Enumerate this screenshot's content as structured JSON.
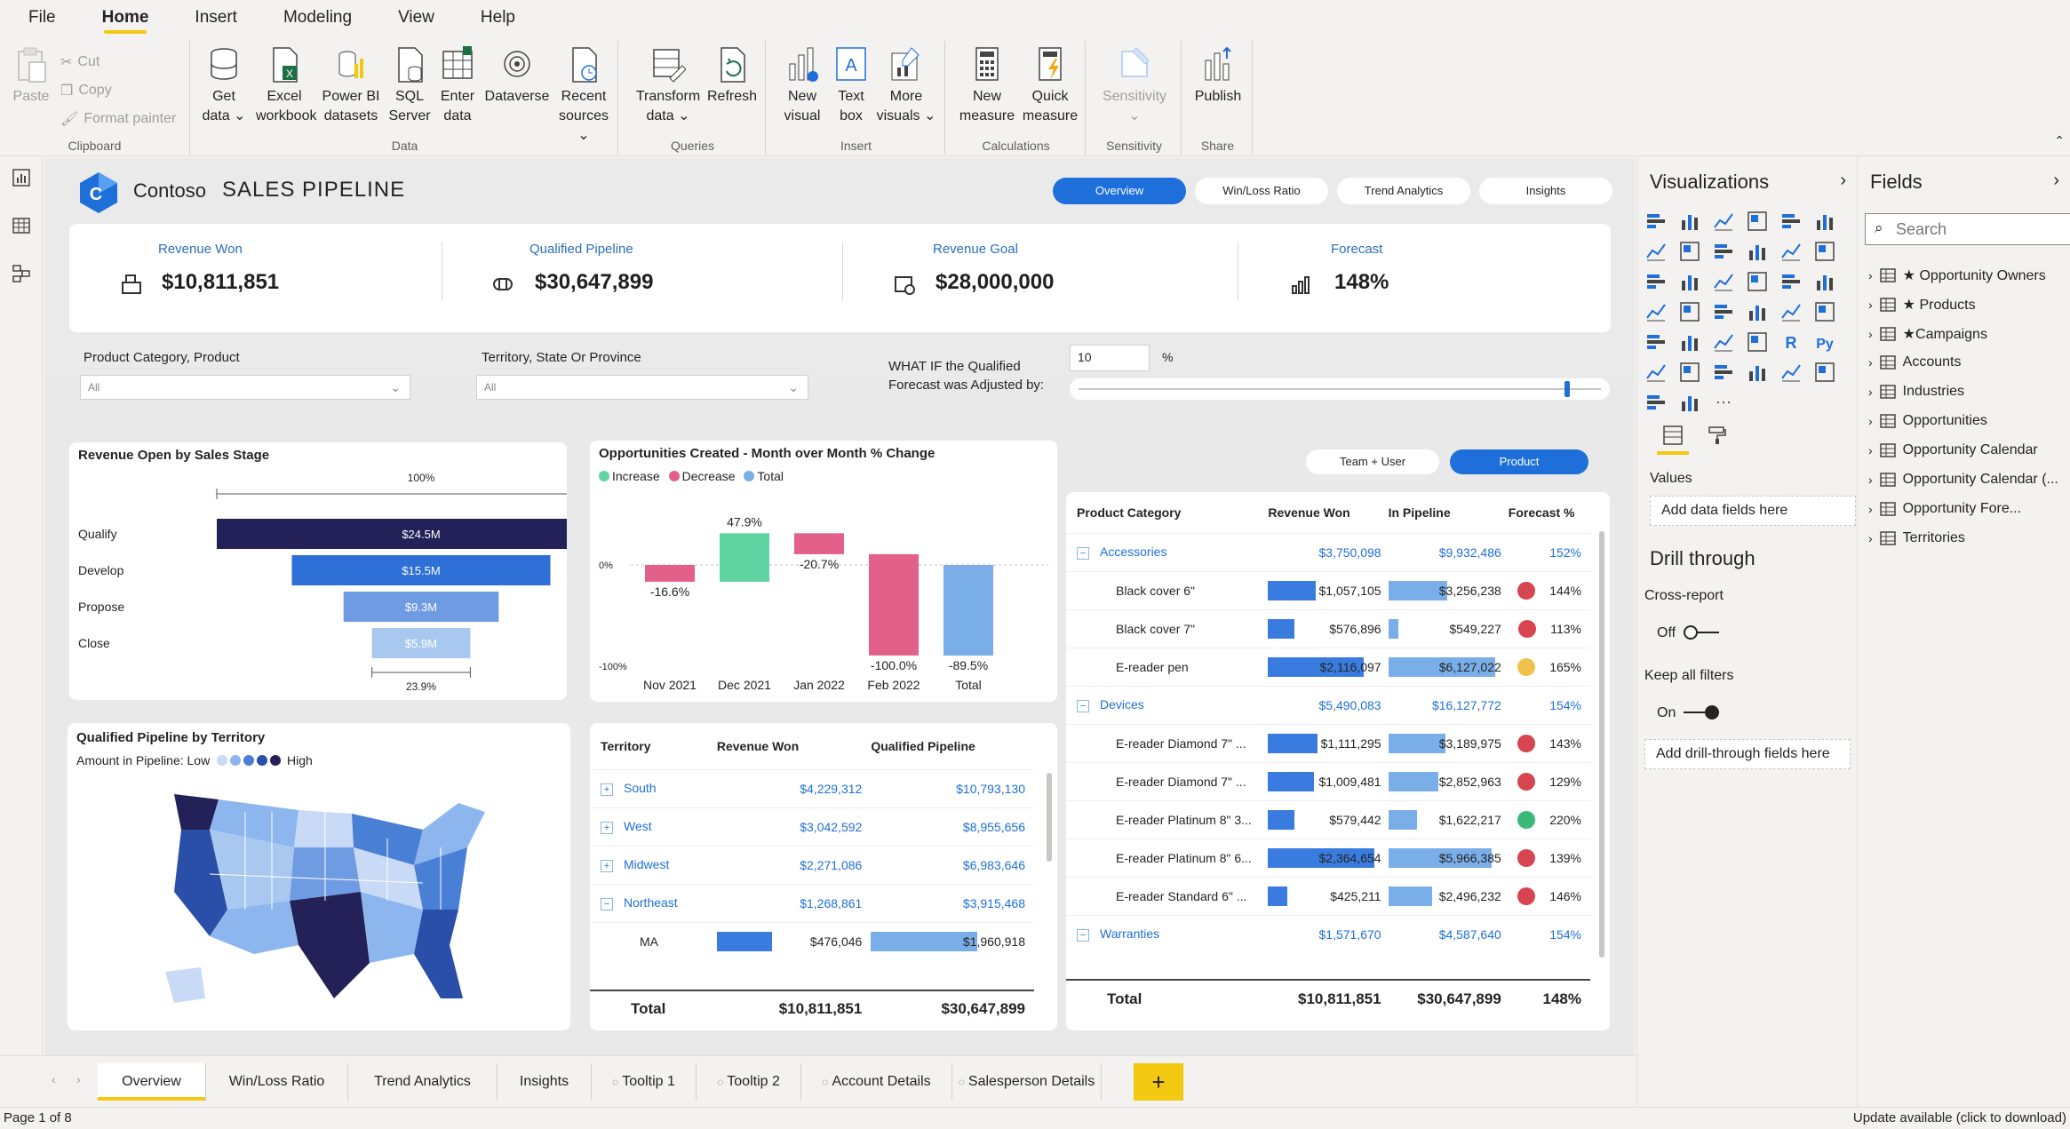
{
  "menu": [
    "File",
    "Home",
    "Insert",
    "Modeling",
    "View",
    "Help"
  ],
  "ribbon": {
    "clipboard": {
      "paste": "Paste",
      "cut": "Cut",
      "copy": "Copy",
      "format_painter": "Format painter",
      "label": "Clipboard"
    },
    "data": {
      "get_data_1": "Get",
      "get_data_2": "data",
      "excel_1": "Excel",
      "excel_2": "workbook",
      "pbi_1": "Power BI",
      "pbi_2": "datasets",
      "sql_1": "SQL",
      "sql_2": "Server",
      "enter_1": "Enter",
      "enter_2": "data",
      "dataverse": "Dataverse",
      "recent_1": "Recent",
      "recent_2": "sources",
      "label": "Data"
    },
    "queries": {
      "transform_1": "Transform",
      "transform_2": "data",
      "refresh": "Refresh",
      "label": "Queries"
    },
    "insert": {
      "new_visual_1": "New",
      "new_visual_2": "visual",
      "textbox_1": "Text",
      "textbox_2": "box",
      "more_1": "More",
      "more_2": "visuals",
      "label": "Insert"
    },
    "calculations": {
      "new_measure_1": "New",
      "new_measure_2": "measure",
      "quick_1": "Quick",
      "quick_2": "measure",
      "label": "Calculations"
    },
    "sensitivity": {
      "btn": "Sensitivity",
      "label": "Sensitivity"
    },
    "share": {
      "publish": "Publish",
      "label": "Share"
    }
  },
  "report": {
    "brand": "Contoso",
    "title": "SALES PIPELINE",
    "nav": [
      "Overview",
      "Win/Loss Ratio",
      "Trend Analytics",
      "Insights"
    ],
    "kpis": [
      {
        "label": "Revenue Won",
        "value": "$10,811,851"
      },
      {
        "label": "Qualified Pipeline",
        "value": "$30,647,899"
      },
      {
        "label": "Revenue Goal",
        "value": "$28,000,000"
      },
      {
        "label": "Forecast",
        "value": "148%"
      }
    ],
    "slicers": {
      "product_label": "Product Category, Product",
      "product_value": "All",
      "territory_label": "Territory, State Or Province",
      "territory_value": "All",
      "whatif_label_1": "WHAT IF the Qualified",
      "whatif_label_2": "Forecast was Adjusted by:",
      "whatif_value": "10",
      "whatif_unit": "%",
      "whatif_level": 0.93
    }
  },
  "chart_data": [
    {
      "type": "bar",
      "title": "Revenue Open by Sales Stage",
      "categories": [
        "Qualify",
        "Develop",
        "Propose",
        "Close"
      ],
      "values": [
        24.5,
        15.5,
        9.3,
        5.9
      ],
      "labels": [
        "$24.5M",
        "$15.5M",
        "$9.3M",
        "$5.9M"
      ],
      "top_label": "100%",
      "bottom_label": "23.9%"
    },
    {
      "type": "bar",
      "title": "Opportunities Created - Month over Month % Change",
      "legend": [
        "Increase",
        "Decrease",
        "Total"
      ],
      "categories": [
        "Nov 2021",
        "Dec 2021",
        "Jan 2022",
        "Feb 2022",
        "Total"
      ],
      "values": [
        -16.6,
        47.9,
        -20.7,
        -100.0,
        -89.5
      ],
      "labels": [
        "-16.6%",
        "47.9%",
        "-20.7%",
        "-100.0%",
        "-89.5%"
      ],
      "yticks": [
        "0%",
        "-100%"
      ]
    }
  ],
  "map": {
    "title": "Qualified Pipeline by Territory",
    "legend_label": "Amount in Pipeline: Low",
    "legend_high": "High"
  },
  "territory_table": {
    "headers": [
      "Territory",
      "Revenue Won",
      "Qualified Pipeline"
    ],
    "rows": [
      {
        "name": "South",
        "won": "$4,229,312",
        "pipe": "$10,793,130"
      },
      {
        "name": "West",
        "won": "$3,042,592",
        "pipe": "$8,955,656"
      },
      {
        "name": "Midwest",
        "won": "$2,271,086",
        "pipe": "$6,983,646"
      },
      {
        "name": "Northeast",
        "won": "$1,268,861",
        "pipe": "$3,915,468"
      }
    ],
    "sub": {
      "name": "MA",
      "won": "$476,046",
      "pipe": "$1,960,918"
    },
    "total": {
      "label": "Total",
      "won": "$10,811,851",
      "pipe": "$30,647,899"
    }
  },
  "product_table": {
    "toggle": [
      "Team + User",
      "Product"
    ],
    "headers": [
      "Product Category",
      "Revenue Won",
      "In Pipeline",
      "Forecast %"
    ],
    "rows": [
      {
        "type": "cat",
        "name": "Accessories",
        "won": "$3,750,098",
        "pipe": "$9,932,486",
        "fc": "152%"
      },
      {
        "type": "item",
        "name": "Black cover 6\"",
        "won": "$1,057,105",
        "pipe": "$3,256,238",
        "fc": "144%",
        "dot": "#d64550",
        "wf": 0.45,
        "pf": 0.55
      },
      {
        "type": "item",
        "name": "Black cover 7\"",
        "won": "$576,896",
        "pipe": "$549,227",
        "fc": "113%",
        "dot": "#d64550",
        "wf": 0.25,
        "pf": 0.09
      },
      {
        "type": "item",
        "name": "E-reader pen",
        "won": "$2,116,097",
        "pipe": "$6,127,022",
        "fc": "165%",
        "dot": "#f0c24b",
        "wf": 0.9,
        "pf": 1.0
      },
      {
        "type": "cat",
        "name": "Devices",
        "won": "$5,490,083",
        "pipe": "$16,127,772",
        "fc": "154%"
      },
      {
        "type": "item",
        "name": "E-reader Diamond 7\" ...",
        "won": "$1,111,295",
        "pipe": "$3,189,975",
        "fc": "143%",
        "dot": "#d64550",
        "wf": 0.47,
        "pf": 0.53
      },
      {
        "type": "item",
        "name": "E-reader Diamond 7\" ...",
        "won": "$1,009,481",
        "pipe": "$2,852,963",
        "fc": "129%",
        "dot": "#d64550",
        "wf": 0.43,
        "pf": 0.47
      },
      {
        "type": "item",
        "name": "E-reader Platinum 8\" 3...",
        "won": "$579,442",
        "pipe": "$1,622,217",
        "fc": "220%",
        "dot": "#3cb878",
        "wf": 0.25,
        "pf": 0.27
      },
      {
        "type": "item",
        "name": "E-reader Platinum 8\" 6...",
        "won": "$2,364,654",
        "pipe": "$5,966,385",
        "fc": "139%",
        "dot": "#d64550",
        "wf": 1.0,
        "pf": 0.97
      },
      {
        "type": "item",
        "name": "E-reader Standard 6\" ...",
        "won": "$425,211",
        "pipe": "$2,496,232",
        "fc": "146%",
        "dot": "#d64550",
        "wf": 0.18,
        "pf": 0.41
      },
      {
        "type": "cat",
        "name": "Warranties",
        "won": "$1,571,670",
        "pipe": "$4,587,640",
        "fc": "154%"
      }
    ],
    "total": {
      "label": "Total",
      "won": "$10,811,851",
      "pipe": "$30,647,899",
      "fc": "148%"
    }
  },
  "viz_pane": {
    "title": "Visualizations",
    "values_label": "Values",
    "values_well": "Add data fields here",
    "drill_title": "Drill through",
    "cross_report": "Cross-report",
    "cross_state": "Off",
    "keep_filters": "Keep all filters",
    "keep_state": "On",
    "drill_well": "Add drill-through fields here"
  },
  "fields_pane": {
    "title": "Fields",
    "search_placeholder": "Search",
    "items": [
      "★ Opportunity Owners",
      "★ Products",
      "★Campaigns",
      "Accounts",
      "Industries",
      "Opportunities",
      "Opportunity Calendar",
      "Opportunity Calendar (...",
      "Opportunity Fore...",
      "Territories"
    ]
  },
  "page_tabs": [
    "Overview",
    "Win/Loss Ratio",
    "Trend Analytics",
    "Insights",
    "Tooltip 1",
    "Tooltip 2",
    "Account Details",
    "Salesperson Details"
  ],
  "add_tab": "+",
  "status": {
    "page": "Page 1 of 8",
    "update": "Update available (click to download)"
  },
  "colors": {
    "accent": "#1e6fd9",
    "navy": "#232157",
    "increase": "#5fd3a1",
    "decrease": "#e2608a",
    "total": "#7aaee8",
    "yellow": "#f2c811"
  }
}
